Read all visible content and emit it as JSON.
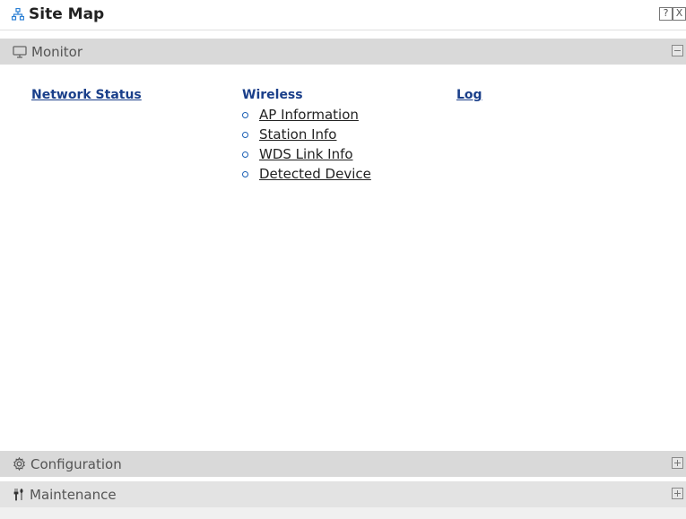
{
  "window": {
    "title": "Site Map",
    "help_button": "?",
    "close_button": "X"
  },
  "sections": {
    "monitor": {
      "label": "Monitor",
      "state": "expanded",
      "links": {
        "network_status": "Network Status",
        "wireless": "Wireless",
        "wireless_items": [
          "AP Information",
          "Station Info",
          "WDS Link Info",
          "Detected Device"
        ],
        "log": "Log"
      }
    },
    "configuration": {
      "label": "Configuration",
      "state": "collapsed"
    },
    "maintenance": {
      "label": "Maintenance",
      "state": "collapsed"
    }
  },
  "colors": {
    "link_heading": "#1a3f8a",
    "section_header_bg": "#d9d9d9",
    "bullet": "#1a5fb4",
    "icon_blue": "#2a7fd4"
  },
  "icons": {
    "title": "sitemap-icon",
    "monitor": "monitor-icon",
    "configuration": "gear-icon",
    "maintenance": "tools-icon"
  }
}
